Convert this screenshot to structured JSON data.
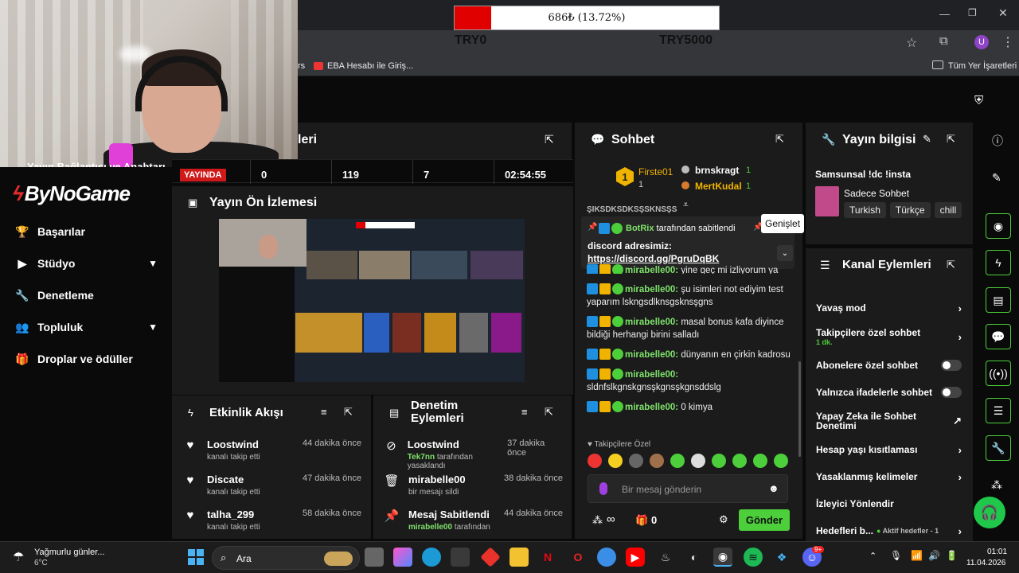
{
  "progress": {
    "text": "686₺ (13.72%)",
    "fraction": 0.1372,
    "left_label": "TRY0",
    "right_label": "TRY5000"
  },
  "browser": {
    "bookmark_left": "rs",
    "bookmark1": "EBA Hesabı ile Giriş...",
    "bookmark_folder": "Tüm Yer İşaretleri",
    "profile": "U"
  },
  "webcam": {
    "overlay_text": "Yayın Bağlantısı ve Anahtarı"
  },
  "sidebar": {
    "logo": "ByNoGame",
    "items": [
      {
        "label": "Başarılar",
        "icon": "trophy-icon"
      },
      {
        "label": "Stüdyo",
        "icon": "video-icon"
      },
      {
        "label": "Denetleme",
        "icon": "wrench-icon"
      },
      {
        "label": "Topluluk",
        "icon": "people-icon"
      },
      {
        "label": "Droplar ve ödüller",
        "icon": "gift-icon"
      }
    ]
  },
  "stats": {
    "panel_title_tail": "leri",
    "live": "YAYINDA",
    "viewers": "0",
    "followers": "119",
    "subs": "7",
    "duration": "02:54:55"
  },
  "preview": {
    "title": "Yayın Ön İzlemesi"
  },
  "activity": {
    "title": "Etkinlik Akışı",
    "items": [
      {
        "name": "Loostwind",
        "sub": "kanalı takip etti",
        "time": "44 dakika önce"
      },
      {
        "name": "Discate",
        "sub": "kanalı takip etti",
        "time": "47 dakika önce"
      },
      {
        "name": "talha_299",
        "sub": "kanalı takip etti",
        "time": "58 dakika önce"
      }
    ]
  },
  "moderation": {
    "title": "Denetim Eylemleri",
    "items": [
      {
        "name": "Loostwind",
        "sub_user": "Tek7nn",
        "sub": "tarafından yasaklandı",
        "time": "37 dakika önce"
      },
      {
        "name": "mirabelle00",
        "sub_user": "",
        "sub": "bir mesajı sildi",
        "time": "38 dakika önce"
      },
      {
        "name": "Mesaj Sabitlendi",
        "sub_user": "mirabelle00",
        "sub": "tarafından",
        "time": "44 dakika önce"
      }
    ]
  },
  "chat": {
    "title": "Sohbet",
    "leader1": {
      "name": "Firste01",
      "count": "1"
    },
    "leader2": {
      "name": "brnskragt",
      "count": "1"
    },
    "leader3": {
      "name": "MertKudal",
      "count": "1"
    },
    "cut_text": "ŞIKSDKSDKSŞSKNSŞS",
    "pinned_by": "BotRix",
    "pinned_suffix": "tarafından sabitlendi",
    "expand_tip": "Genişlet",
    "pinned_text": "discord adresimiz:",
    "pinned_link": "https://discord.gg/PgruDqBK",
    "partial_msg": "yine geç mi izliyorum ya",
    "messages": [
      {
        "user": "mirabelle00",
        "text": "şu isimleri not ediyim test yaparım lskngsdlknsgsknsşgns"
      },
      {
        "user": "mirabelle00",
        "text": "masal bonus kafa diyince bildiği herhangi birini salladı"
      },
      {
        "user": "mirabelle00",
        "text": "dünyanın en çirkin kadrosu"
      },
      {
        "user": "mirabelle00",
        "text": "sldnfslkgnskgnsşkgnsşkgnsddslg"
      },
      {
        "user": "mirabelle00",
        "text": "0 kimya"
      }
    ],
    "followers_only": "Takipçilere Özel",
    "input_placeholder": "Bir mesaj gönderin",
    "points": "∞",
    "gift_count": "0",
    "send": "Gönder"
  },
  "stream_info": {
    "title": "Yayın bilgisi",
    "stream_title": "Samsunsal !dc !insta",
    "category": "Sadece Sohbet",
    "tags": [
      "Turkish",
      "Türkçe",
      "chill"
    ]
  },
  "channel_actions": {
    "title": "Kanal Eylemleri",
    "items": [
      {
        "label": "Yavaş mod",
        "sub": "",
        "control": "chevron"
      },
      {
        "label": "Takipçilere özel sohbet",
        "sub": "1 dk.",
        "control": "chevron"
      },
      {
        "label": "Abonelere özel sohbet",
        "sub": "",
        "control": "toggle"
      },
      {
        "label": "Yalnızca ifadelerle sohbet",
        "sub": "",
        "control": "toggle"
      },
      {
        "label": "Yapay Zeka ile Sohbet Denetimi",
        "sub": "",
        "control": "external"
      },
      {
        "label": "Hesap yaşı kısıtlaması",
        "sub": "",
        "control": "chevron"
      },
      {
        "label": "Yasaklanmış kelimeler",
        "sub": "",
        "control": "chevron"
      },
      {
        "label": "İzleyici Yönlendir",
        "sub": "",
        "control": "none"
      },
      {
        "label": "Hedefleri b...",
        "sub": "Aktif hedefler - 1",
        "control": "chevron"
      }
    ]
  },
  "taskbar": {
    "weather_title": "Yağmurlu günler...",
    "weather_temp": "6°C",
    "search": "Ara",
    "time": "01:01",
    "date": "11.04.2026",
    "badge": "9+"
  },
  "colors": {
    "accent": "#4ccf3a",
    "live_red": "#d01a1a",
    "panel": "#1b1b1b",
    "progress_red": "#e00000"
  }
}
